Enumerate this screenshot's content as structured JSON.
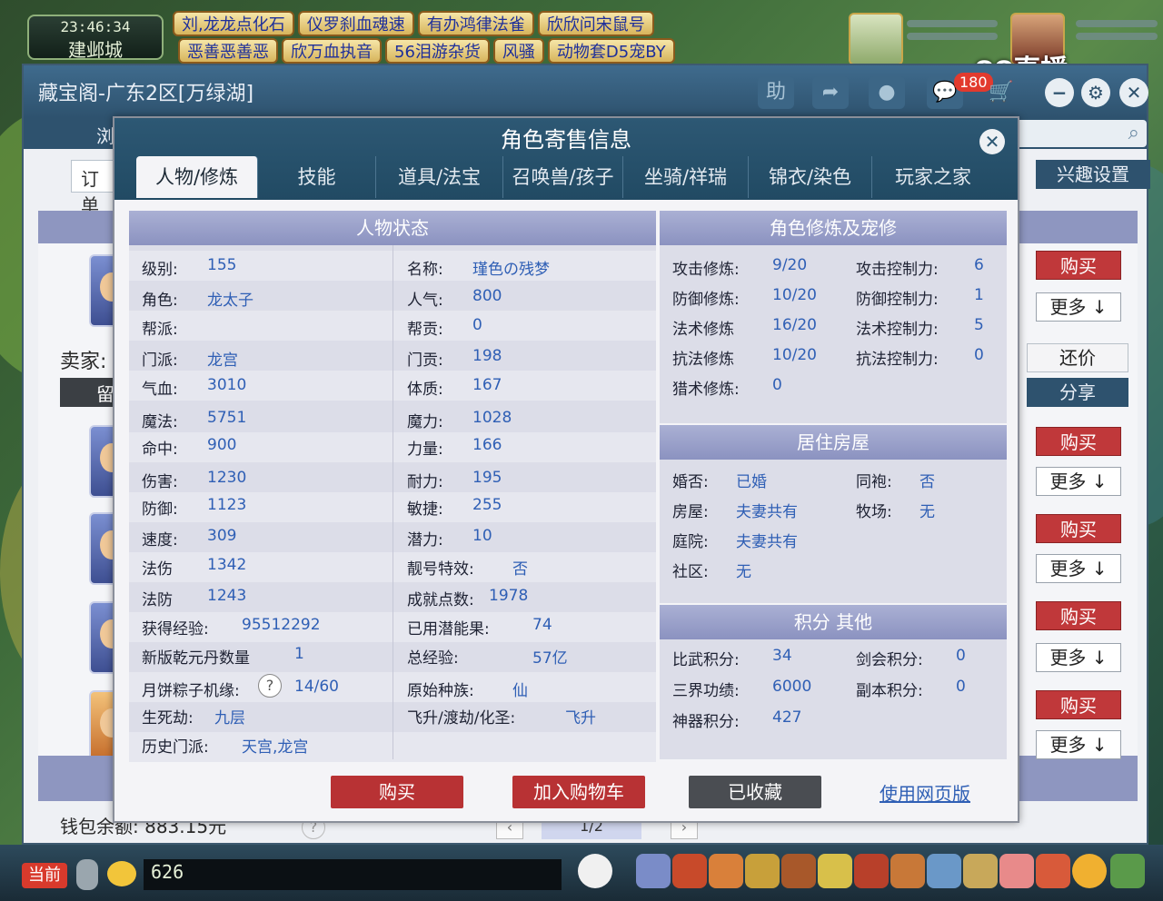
{
  "game": {
    "clock": "23:46:34",
    "city": "建邺城",
    "banners_row1": [
      "刘,龙龙点化石",
      "仪罗刹血魂速",
      "有办鸿律法雀",
      "欣欣问宋鼠号"
    ],
    "banners_row2": [
      "恶善恶善恶",
      "欣万血执音",
      "56泪游杂货",
      "风骚",
      "动物套D5宠BY"
    ],
    "cc_logo": "CC直播",
    "chat_channel": "当前",
    "chat_value": "626"
  },
  "store": {
    "title": "藏宝阁-广东2区[万绿湖]",
    "toolbar": {
      "help": "助",
      "message_count": "180"
    },
    "browse_tab": "浏",
    "order_tab": "订单",
    "interest_settings": "兴趣设置",
    "seller_label": "卖家:",
    "leave_message": "留",
    "buy": "购买",
    "more": "更多",
    "counter_offer": "还价",
    "share": "分享",
    "wallet": "钱包余额: 883.15元",
    "pager": "1/2"
  },
  "modal": {
    "title": "角色寄售信息",
    "tabs": [
      "人物/修炼",
      "技能",
      "道具/法宝",
      "召唤兽/孩子",
      "坐骑/祥瑞",
      "锦衣/染色",
      "玩家之家"
    ],
    "status_panel": {
      "title": "人物状态",
      "left": [
        {
          "k": "级别:",
          "v": "155"
        },
        {
          "k": "角色:",
          "v": "龙太子"
        },
        {
          "k": "帮派:",
          "v": ""
        },
        {
          "k": "门派:",
          "v": "龙宫"
        },
        {
          "k": "气血:",
          "v": "3010"
        },
        {
          "k": "魔法:",
          "v": "5751"
        },
        {
          "k": "命中:",
          "v": "900"
        },
        {
          "k": "伤害:",
          "v": "1230"
        },
        {
          "k": "防御:",
          "v": "1123"
        },
        {
          "k": "速度:",
          "v": "309"
        },
        {
          "k": "法伤",
          "v": "1342"
        },
        {
          "k": "法防",
          "v": "1243"
        },
        {
          "k": "获得经验:",
          "v": "95512292"
        },
        {
          "k": "新版乾元丹数量",
          "v": "1"
        },
        {
          "k": "月饼粽子机缘:",
          "v": "14/60"
        },
        {
          "k": "生死劫:",
          "v": "九层"
        },
        {
          "k": "历史门派:",
          "v": "天宫,龙宫"
        }
      ],
      "right": [
        {
          "k": "名称:",
          "v": "瑾色の残梦"
        },
        {
          "k": "人气:",
          "v": "800"
        },
        {
          "k": "帮贡:",
          "v": "0"
        },
        {
          "k": "门贡:",
          "v": "198"
        },
        {
          "k": "体质:",
          "v": "167"
        },
        {
          "k": "魔力:",
          "v": "1028"
        },
        {
          "k": "力量:",
          "v": "166"
        },
        {
          "k": "耐力:",
          "v": "195"
        },
        {
          "k": "敏捷:",
          "v": "255"
        },
        {
          "k": "潜力:",
          "v": "10"
        },
        {
          "k": "靓号特效:",
          "v": "否"
        },
        {
          "k": "成就点数:",
          "v": "1978"
        },
        {
          "k": "已用潜能果:",
          "v": "74"
        },
        {
          "k": "总经验:",
          "v": "57亿"
        },
        {
          "k": "原始种族:",
          "v": "仙"
        },
        {
          "k": "飞升/渡劫/化圣:",
          "v": "飞升"
        }
      ]
    },
    "cultivation_panel": {
      "title": "角色修炼及宠修",
      "rows": [
        {
          "k1": "攻击修炼:",
          "v1": "9/20",
          "k2": "攻击控制力:",
          "v2": "6"
        },
        {
          "k1": "防御修炼:",
          "v1": "10/20",
          "k2": "防御控制力:",
          "v2": "1"
        },
        {
          "k1": "法术修炼",
          "v1": "16/20",
          "k2": "法术控制力:",
          "v2": "5"
        },
        {
          "k1": "抗法修炼",
          "v1": "10/20",
          "k2": "抗法控制力:",
          "v2": "0"
        },
        {
          "k1": "猎术修炼:",
          "v1": "0",
          "k2": "",
          "v2": ""
        }
      ]
    },
    "house_panel": {
      "title": "居住房屋",
      "rows": [
        {
          "k1": "婚否:",
          "v1": "已婚",
          "k2": "同袍:",
          "v2": "否"
        },
        {
          "k1": "房屋:",
          "v1": "夫妻共有",
          "k2": "牧场:",
          "v2": "无"
        },
        {
          "k1": "庭院:",
          "v1": "夫妻共有",
          "k2": "",
          "v2": ""
        },
        {
          "k1": "社区:",
          "v1": "无",
          "k2": "",
          "v2": ""
        }
      ]
    },
    "points_panel": {
      "title": "积分 其他",
      "rows": [
        {
          "k1": "比武积分:",
          "v1": "34",
          "k2": "剑会积分:",
          "v2": "0"
        },
        {
          "k1": "三界功绩:",
          "v1": "6000",
          "k2": "副本积分:",
          "v2": "0"
        },
        {
          "k1": "神器积分:",
          "v1": "427",
          "k2": "",
          "v2": ""
        }
      ]
    },
    "buttons": {
      "buy": "购买",
      "add_cart": "加入购物车",
      "favorited": "已收藏",
      "web_version": "使用网页版"
    }
  },
  "colors": {
    "accent": "#2e526e",
    "buy_red": "#c0383a",
    "value_blue": "#2f5fb5",
    "panel_head": "#8b92c0"
  }
}
